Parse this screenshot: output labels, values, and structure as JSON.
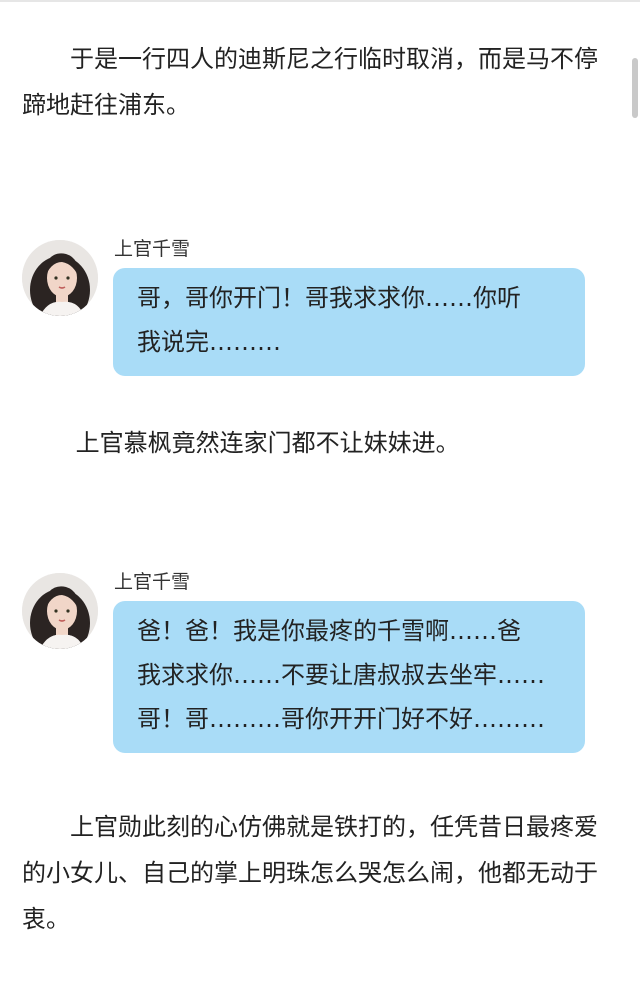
{
  "paragraphs": {
    "p1": "于是一行四人的迪斯尼之行临时取消，而是马不停蹄地赶往浦东。",
    "p2": "上官慕枫竟然连家门都不让妹妹进。",
    "p3": "上官勋此刻的心仿佛就是铁打的，任凭昔日最疼爱的小女儿、自己的掌上明珠怎么哭怎么闹，他都无动于衷。"
  },
  "chats": [
    {
      "sender": "上官千雪",
      "avatar": "avatar-girl-icon",
      "lines": [
        "哥，哥你开门！哥我求求你……你听",
        "我说完………"
      ]
    },
    {
      "sender": "上官千雪",
      "avatar": "avatar-girl-icon",
      "lines": [
        "爸！爸！我是你最疼的千雪啊……爸",
        "我求求你……不要让唐叔叔去坐牢……",
        "哥！哥………哥你开开门好不好………"
      ]
    }
  ],
  "colors": {
    "bubble": "#a9dcf7",
    "text": "#222222"
  }
}
